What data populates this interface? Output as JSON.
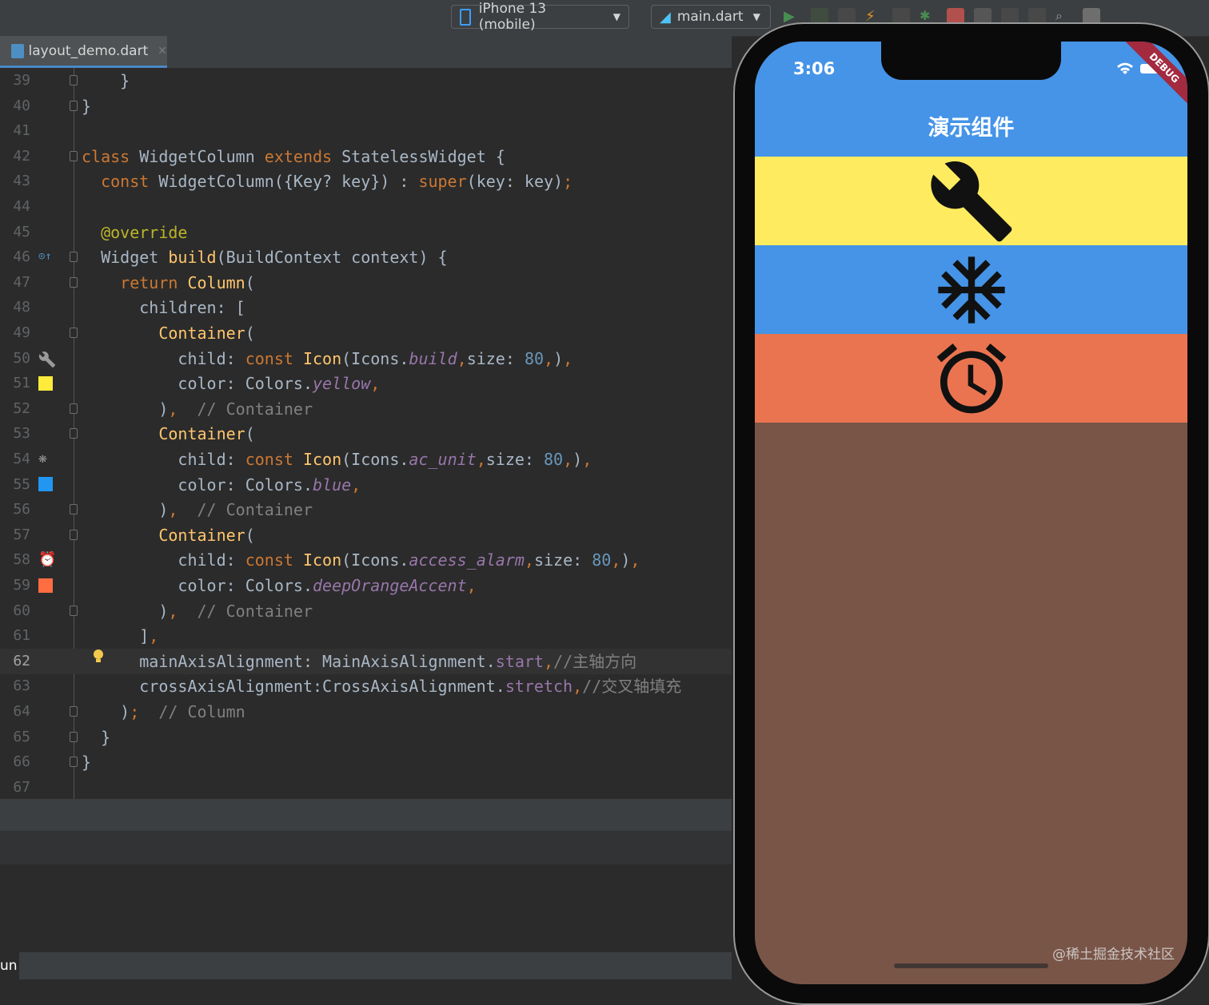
{
  "toolbar": {
    "device": "iPhone 13 (mobile)",
    "config": "main.dart"
  },
  "tab": {
    "label": "layout_demo.dart"
  },
  "editor": {
    "lines": [
      {
        "n": "39",
        "segs": [
          {
            "t": "    }",
            "c": ""
          }
        ]
      },
      {
        "n": "40",
        "segs": [
          {
            "t": "}",
            "c": ""
          }
        ]
      },
      {
        "n": "41",
        "segs": [
          {
            "t": "",
            "c": ""
          }
        ]
      },
      {
        "n": "42",
        "segs": [
          {
            "t": "class ",
            "c": "kw"
          },
          {
            "t": "WidgetColumn ",
            "c": ""
          },
          {
            "t": "extends ",
            "c": "kw"
          },
          {
            "t": "StatelessWidget {",
            "c": ""
          }
        ]
      },
      {
        "n": "43",
        "segs": [
          {
            "t": "  const ",
            "c": "kw"
          },
          {
            "t": "WidgetColumn({Key? key}) : ",
            "c": ""
          },
          {
            "t": "super",
            "c": "kw"
          },
          {
            "t": "(key: key)",
            "c": ""
          },
          {
            "t": ";",
            "c": "kw"
          }
        ]
      },
      {
        "n": "44",
        "segs": [
          {
            "t": "",
            "c": ""
          }
        ]
      },
      {
        "n": "45",
        "segs": [
          {
            "t": "  ",
            "c": ""
          },
          {
            "t": "@override",
            "c": "an"
          }
        ]
      },
      {
        "n": "46",
        "segs": [
          {
            "t": "  Widget ",
            "c": ""
          },
          {
            "t": "build",
            "c": "fn"
          },
          {
            "t": "(BuildContext context) {",
            "c": ""
          }
        ]
      },
      {
        "n": "47",
        "segs": [
          {
            "t": "    return ",
            "c": "kw"
          },
          {
            "t": "Column",
            "c": "fn"
          },
          {
            "t": "(",
            "c": ""
          }
        ]
      },
      {
        "n": "48",
        "segs": [
          {
            "t": "      children: [",
            "c": ""
          }
        ]
      },
      {
        "n": "49",
        "segs": [
          {
            "t": "        ",
            "c": ""
          },
          {
            "t": "Container",
            "c": "fn"
          },
          {
            "t": "(",
            "c": ""
          }
        ]
      },
      {
        "n": "50",
        "segs": [
          {
            "t": "          child: ",
            "c": ""
          },
          {
            "t": "const ",
            "c": "kw"
          },
          {
            "t": "Icon",
            "c": "fn"
          },
          {
            "t": "(Icons.",
            "c": ""
          },
          {
            "t": "build",
            "c": "it"
          },
          {
            "t": ",",
            "c": "kw"
          },
          {
            "t": "size: ",
            "c": ""
          },
          {
            "t": "80",
            "c": "num"
          },
          {
            "t": ",",
            "c": "kw"
          },
          {
            "t": ")",
            "c": ""
          },
          {
            "t": ",",
            "c": "kw"
          }
        ]
      },
      {
        "n": "51",
        "segs": [
          {
            "t": "          color: Colors.",
            "c": ""
          },
          {
            "t": "yellow",
            "c": "it"
          },
          {
            "t": ",",
            "c": "kw"
          }
        ]
      },
      {
        "n": "52",
        "segs": [
          {
            "t": "        )",
            "c": ""
          },
          {
            "t": ",  ",
            "c": "kw"
          },
          {
            "t": "// Container",
            "c": "cm"
          }
        ]
      },
      {
        "n": "53",
        "segs": [
          {
            "t": "        ",
            "c": ""
          },
          {
            "t": "Container",
            "c": "fn"
          },
          {
            "t": "(",
            "c": ""
          }
        ]
      },
      {
        "n": "54",
        "segs": [
          {
            "t": "          child: ",
            "c": ""
          },
          {
            "t": "const ",
            "c": "kw"
          },
          {
            "t": "Icon",
            "c": "fn"
          },
          {
            "t": "(Icons.",
            "c": ""
          },
          {
            "t": "ac_unit",
            "c": "it"
          },
          {
            "t": ",",
            "c": "kw"
          },
          {
            "t": "size: ",
            "c": ""
          },
          {
            "t": "80",
            "c": "num"
          },
          {
            "t": ",",
            "c": "kw"
          },
          {
            "t": ")",
            "c": ""
          },
          {
            "t": ",",
            "c": "kw"
          }
        ]
      },
      {
        "n": "55",
        "segs": [
          {
            "t": "          color: Colors.",
            "c": ""
          },
          {
            "t": "blue",
            "c": "it"
          },
          {
            "t": ",",
            "c": "kw"
          }
        ]
      },
      {
        "n": "56",
        "segs": [
          {
            "t": "        )",
            "c": ""
          },
          {
            "t": ",  ",
            "c": "kw"
          },
          {
            "t": "// Container",
            "c": "cm"
          }
        ]
      },
      {
        "n": "57",
        "segs": [
          {
            "t": "        ",
            "c": ""
          },
          {
            "t": "Container",
            "c": "fn"
          },
          {
            "t": "(",
            "c": ""
          }
        ]
      },
      {
        "n": "58",
        "segs": [
          {
            "t": "          child: ",
            "c": ""
          },
          {
            "t": "const ",
            "c": "kw"
          },
          {
            "t": "Icon",
            "c": "fn"
          },
          {
            "t": "(Icons.",
            "c": ""
          },
          {
            "t": "access_alarm",
            "c": "it"
          },
          {
            "t": ",",
            "c": "kw"
          },
          {
            "t": "size: ",
            "c": ""
          },
          {
            "t": "80",
            "c": "num"
          },
          {
            "t": ",",
            "c": "kw"
          },
          {
            "t": ")",
            "c": ""
          },
          {
            "t": ",",
            "c": "kw"
          }
        ]
      },
      {
        "n": "59",
        "segs": [
          {
            "t": "          color: Colors.",
            "c": ""
          },
          {
            "t": "deepOrangeAccent",
            "c": "it"
          },
          {
            "t": ",",
            "c": "kw"
          }
        ]
      },
      {
        "n": "60",
        "segs": [
          {
            "t": "        )",
            "c": ""
          },
          {
            "t": ",  ",
            "c": "kw"
          },
          {
            "t": "// Container",
            "c": "cm"
          }
        ]
      },
      {
        "n": "61",
        "segs": [
          {
            "t": "      ]",
            "c": ""
          },
          {
            "t": ",",
            "c": "kw"
          }
        ]
      },
      {
        "n": "62",
        "segs": [
          {
            "t": "      mainAxisAlignment: MainAxisAlignment.",
            "c": ""
          },
          {
            "t": "start",
            "c": "pu"
          },
          {
            "t": ",",
            "c": "kw"
          },
          {
            "t": "//主轴方向",
            "c": "cm"
          }
        ]
      },
      {
        "n": "63",
        "segs": [
          {
            "t": "      crossAxisAlignment:CrossAxisAlignment.",
            "c": ""
          },
          {
            "t": "stretch",
            "c": "pu"
          },
          {
            "t": ",",
            "c": "kw"
          },
          {
            "t": "//交叉轴填充",
            "c": "cm"
          }
        ]
      },
      {
        "n": "64",
        "segs": [
          {
            "t": "    )",
            "c": ""
          },
          {
            "t": ";  ",
            "c": "kw"
          },
          {
            "t": "// Column",
            "c": "cm"
          }
        ]
      },
      {
        "n": "65",
        "segs": [
          {
            "t": "  }",
            "c": ""
          }
        ]
      },
      {
        "n": "66",
        "segs": [
          {
            "t": "}",
            "c": ""
          }
        ]
      },
      {
        "n": "67",
        "segs": [
          {
            "t": "",
            "c": ""
          }
        ]
      }
    ]
  },
  "run": {
    "label": "un"
  },
  "phone": {
    "time": "3:06",
    "app_title": "演示组件",
    "debug_label": "DEBUG",
    "rows": [
      {
        "icon": "wrench-icon",
        "color": "#ffeb5f"
      },
      {
        "icon": "snowflake-icon",
        "color": "#4594e8"
      },
      {
        "icon": "alarm-icon",
        "color": "#eb7450"
      }
    ],
    "body_color": "#795548"
  },
  "watermark": "@稀土掘金技术社区"
}
